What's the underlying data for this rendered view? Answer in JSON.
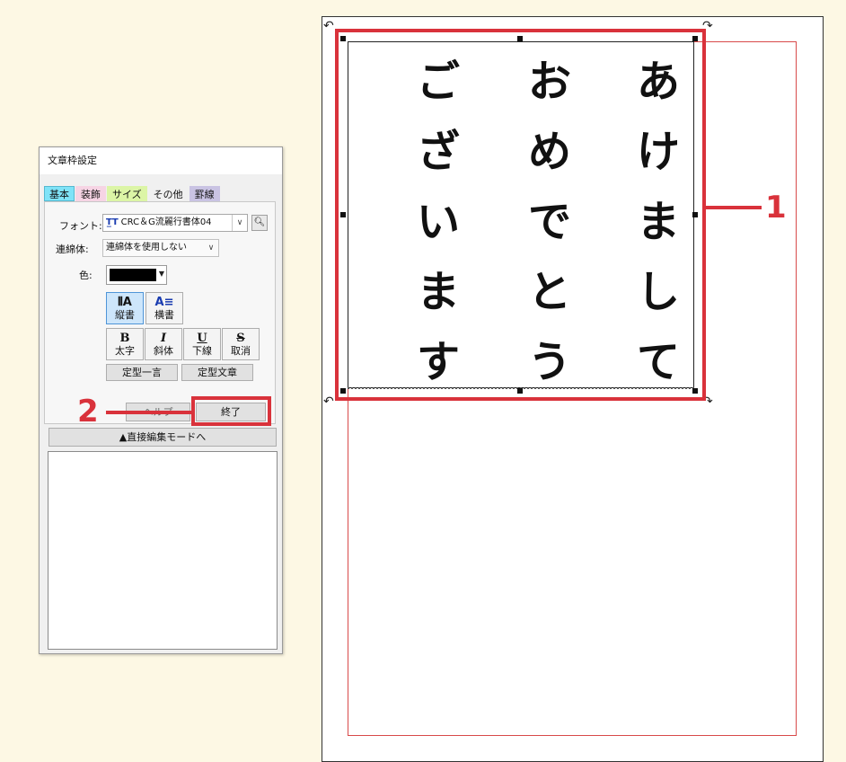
{
  "dialog": {
    "title": "文章枠設定",
    "tabs": [
      "基本",
      "装飾",
      "サイズ",
      "その他",
      "罫線"
    ],
    "font_label": "フォント:",
    "font_value": "CRC＆G流麗行書体04",
    "font_icon_text": "T̲T",
    "renmentai_label": "連綿体:",
    "renmentai_value": "連綿体を使用しない",
    "color_label": "色:",
    "color_value": "#000000",
    "direction_buttons": [
      {
        "glyph": "⫴A",
        "label": "縦書",
        "active": true
      },
      {
        "glyph": "A≡",
        "label": "横書",
        "active": false
      }
    ],
    "style_buttons": [
      {
        "glyph": "B",
        "label": "太字"
      },
      {
        "glyph": "I",
        "label": "斜体"
      },
      {
        "glyph": "U",
        "label": "下線"
      },
      {
        "glyph": "S",
        "label": "取消"
      }
    ],
    "preset_phrase_btn": "定型一言",
    "preset_text_btn": "定型文章",
    "help_btn": "ヘルプ",
    "close_btn": "終了",
    "direct_edit_btn": "▲直接編集モードへ"
  },
  "page": {
    "columns": [
      [
        "あ",
        "け",
        "ま",
        "し",
        "て"
      ],
      [
        "お",
        "め",
        "で",
        "と",
        "う"
      ],
      [
        "ご",
        "ざ",
        "い",
        "ま",
        "す"
      ]
    ]
  },
  "callouts": {
    "one": "1",
    "two": "2",
    "color": "#d9323b"
  }
}
